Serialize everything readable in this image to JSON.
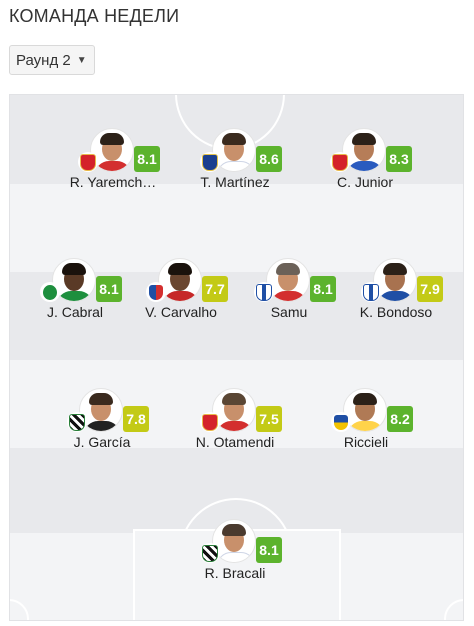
{
  "header": {
    "title": "КОМАНДА НЕДЕЛИ"
  },
  "round_select": {
    "label": "Раунд 2"
  },
  "colors": {
    "rating_green": "#5cb32d",
    "rating_lime": "#c3ca16"
  },
  "players": [
    {
      "name": "R. Yaremch…",
      "rating": "8.1",
      "club": "benfica"
    },
    {
      "name": "T. Martínez",
      "rating": "8.6",
      "club": "porto"
    },
    {
      "name": "C. Junior",
      "rating": "8.3",
      "club": "benfica"
    },
    {
      "name": "J. Cabral",
      "rating": "8.1",
      "club": "sporting"
    },
    {
      "name": "V. Carvalho",
      "rating": "7.7",
      "club": "gil-vicente"
    },
    {
      "name": "Samu",
      "rating": "8.1",
      "club": "famalicao"
    },
    {
      "name": "K. Bondoso",
      "rating": "7.9",
      "club": "famalicao"
    },
    {
      "name": "J. García",
      "rating": "7.8",
      "club": "boavista"
    },
    {
      "name": "N. Otamendi",
      "rating": "7.5",
      "club": "benfica"
    },
    {
      "name": "Riccieli",
      "rating": "8.2",
      "club": "pacos"
    },
    {
      "name": "R. Bracali",
      "rating": "8.1",
      "club": "boavista"
    }
  ]
}
